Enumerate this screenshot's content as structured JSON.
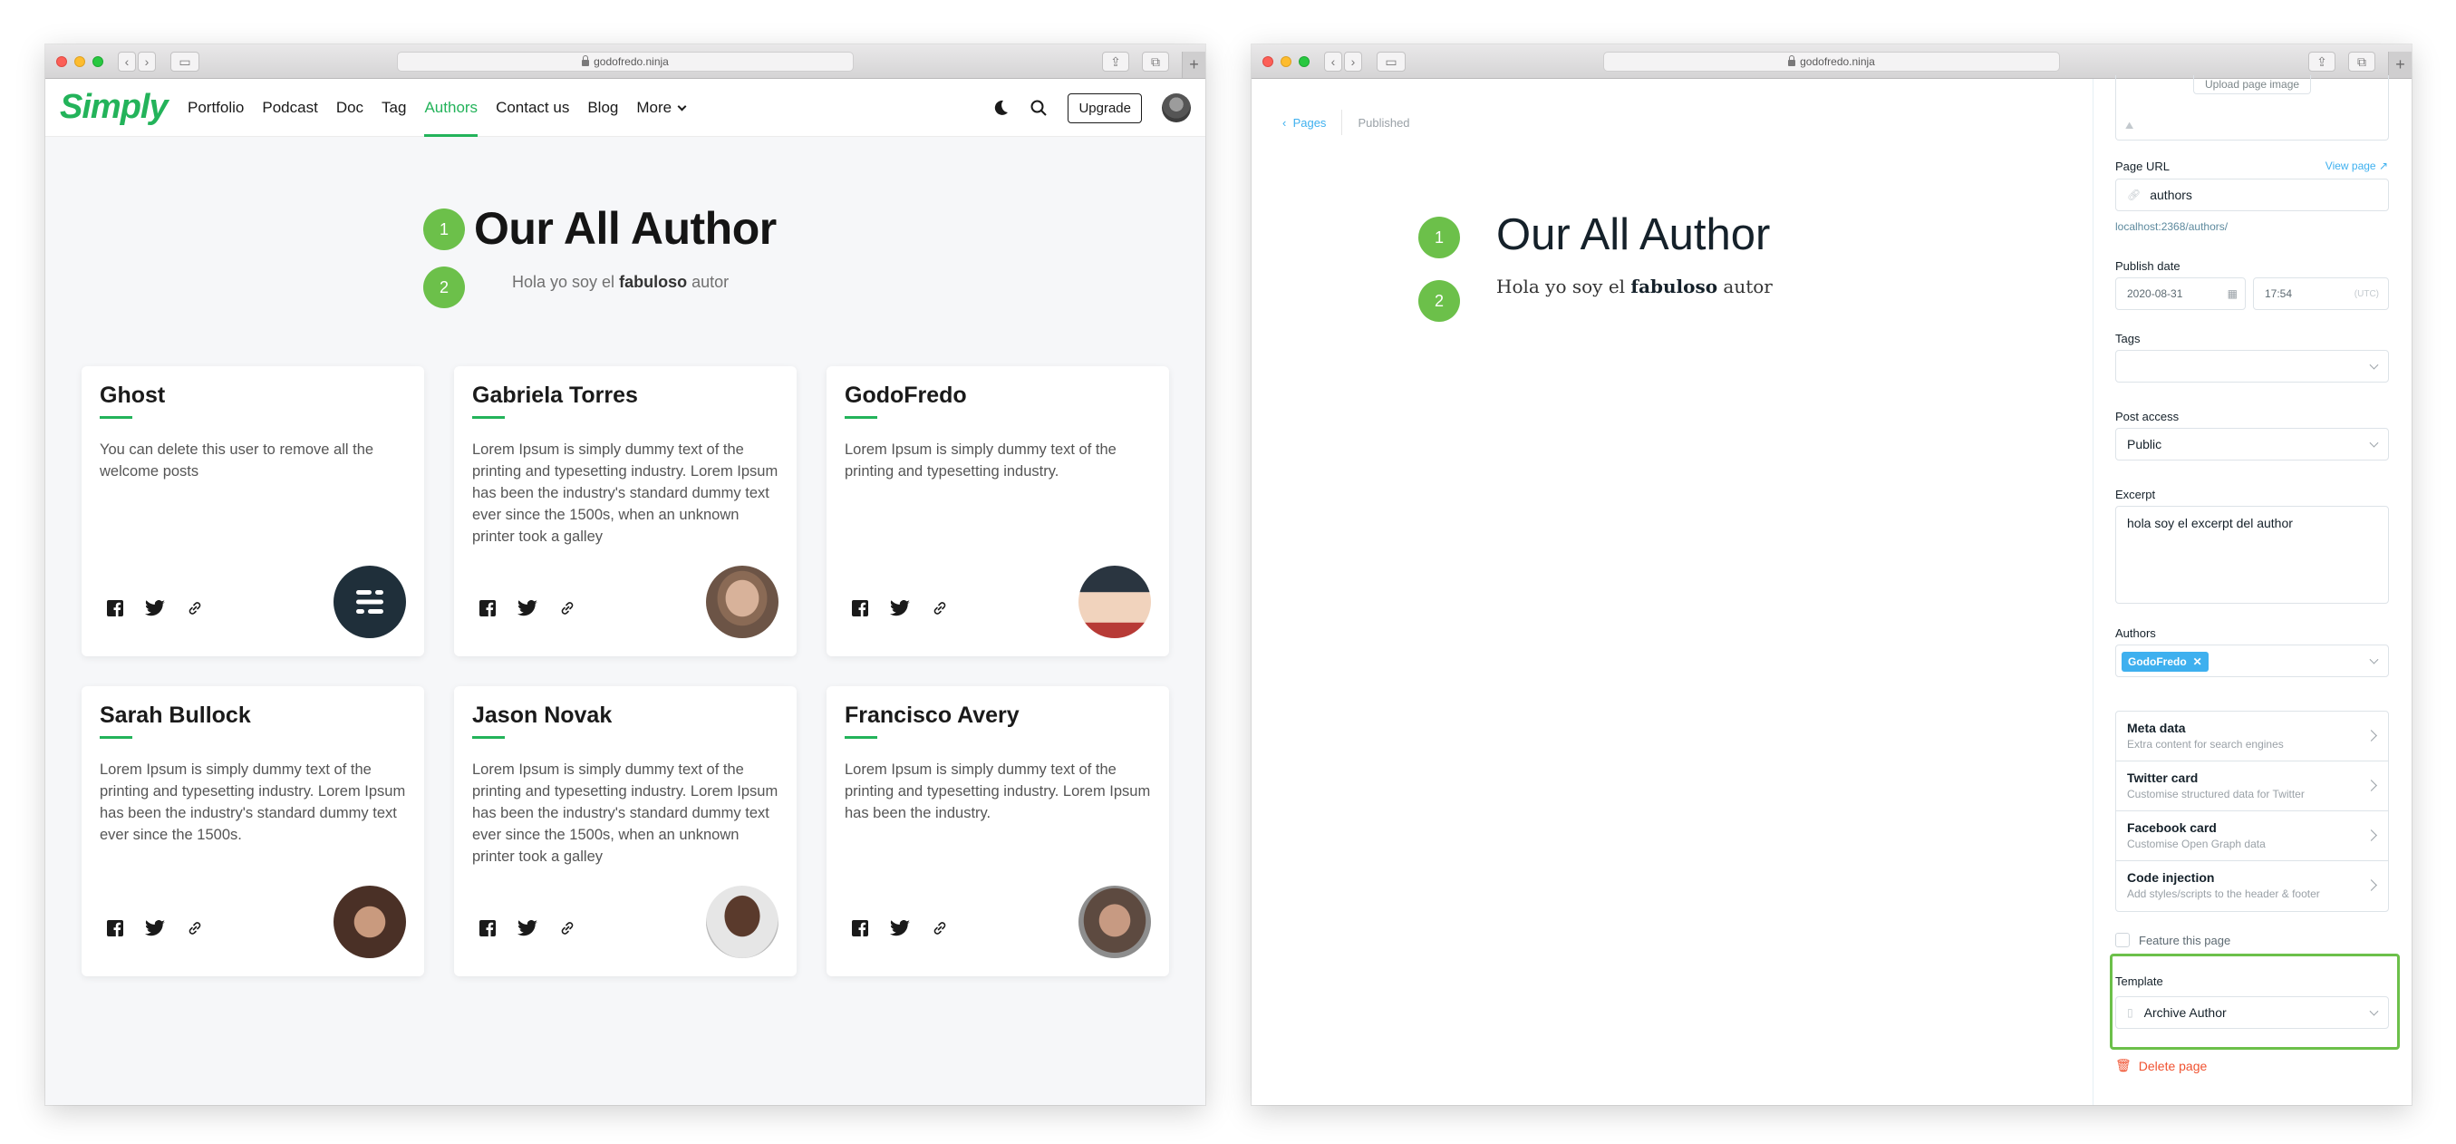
{
  "left": {
    "browser": {
      "url": "godofredo.ninja"
    },
    "site": {
      "logo": "Simply",
      "nav": [
        "Portfolio",
        "Podcast",
        "Doc",
        "Tag",
        "Authors",
        "Contact us",
        "Blog",
        "More"
      ],
      "active_nav": "Authors",
      "upgrade_label": "Upgrade",
      "colors": {
        "accent": "#23b35a",
        "badge": "#6cc04a"
      }
    },
    "page": {
      "badge1": "1",
      "badge2": "2",
      "title": "Our All Author",
      "subtitle_pre": "Hola yo soy el",
      "subtitle_bold": "fabuloso",
      "subtitle_post": "autor"
    },
    "authors": [
      {
        "name": "Ghost",
        "bio": "You can delete this user to remove all the welcome posts",
        "avatar": "ghost-logo"
      },
      {
        "name": "Gabriela Torres",
        "bio": "Lorem Ipsum is simply dummy text of the printing and typesetting industry. Lorem Ipsum has been the industry's standard dummy text ever since the 1500s, when an unknown printer took a galley",
        "avatar": "woman-photo"
      },
      {
        "name": "GodoFredo",
        "bio": "Lorem Ipsum is simply dummy text of the printing and typesetting industry.",
        "avatar": "anime-character"
      },
      {
        "name": "Sarah Bullock",
        "bio": "Lorem Ipsum is simply dummy text of the printing and typesetting industry. Lorem Ipsum has been the industry's standard dummy text ever since the 1500s.",
        "avatar": "woman-photo"
      },
      {
        "name": "Jason Novak",
        "bio": "Lorem Ipsum is simply dummy text of the printing and typesetting industry. Lorem Ipsum has been the industry's standard dummy text ever since the 1500s, when an unknown printer took a galley",
        "avatar": "man-photo"
      },
      {
        "name": "Francisco Avery",
        "bio": "Lorem Ipsum is simply dummy text of the printing and typesetting industry. Lorem Ipsum has been the industry.",
        "avatar": "man-photo"
      }
    ]
  },
  "right": {
    "browser": {
      "url": "godofredo.ninja"
    },
    "breadcrumb": {
      "back": "Pages",
      "status": "Published"
    },
    "editor": {
      "badge1": "1",
      "badge2": "2",
      "title": "Our All Author",
      "excerpt_pre": "Hola yo soy el",
      "excerpt_bold": "fabuloso",
      "excerpt_post": "autor"
    },
    "settings": {
      "upload_label": "Upload page image",
      "page_url_label": "Page URL",
      "view_page": "View page",
      "page_url_value": "authors",
      "page_url_hint": "localhost:2368/authors/",
      "publish_label": "Publish date",
      "publish_date": "2020-08-31",
      "publish_time": "17:54",
      "timezone": "(UTC)",
      "tags_label": "Tags",
      "access_label": "Post access",
      "access_value": "Public",
      "excerpt_label": "Excerpt",
      "excerpt_value": "hola soy el excerpt del author",
      "authors_label": "Authors",
      "author_tag": "GodoFredo",
      "meta": [
        {
          "title": "Meta data",
          "desc": "Extra content for search engines"
        },
        {
          "title": "Twitter card",
          "desc": "Customise structured data for Twitter"
        },
        {
          "title": "Facebook card",
          "desc": "Customise Open Graph data"
        },
        {
          "title": "Code injection",
          "desc": "Add styles/scripts to the header & footer"
        }
      ],
      "feature_label": "Feature this page",
      "template_label": "Template",
      "template_value": "Archive Author",
      "delete_label": "Delete page",
      "colors": {
        "link": "#3eb0ef",
        "danger": "#f05230",
        "highlight": "#6cc04a"
      }
    }
  }
}
